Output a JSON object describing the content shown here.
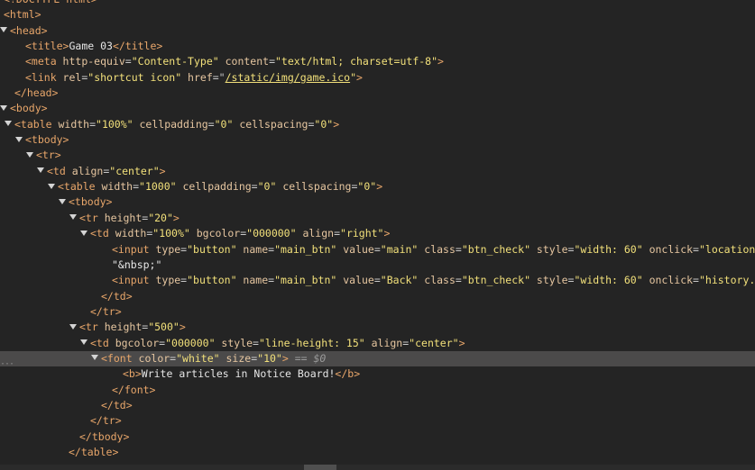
{
  "lines": [
    {
      "indent": 0,
      "toggle": "none",
      "segments": [
        {
          "cls": "tag",
          "text": "<!DOCTYPE html>"
        }
      ]
    },
    {
      "indent": 0,
      "toggle": "none",
      "segments": [
        {
          "cls": "tag",
          "text": "<html>"
        }
      ]
    },
    {
      "indent": 0,
      "toggle": "open",
      "segments": [
        {
          "cls": "tag",
          "text": "<head>"
        }
      ]
    },
    {
      "indent": 2,
      "toggle": "none",
      "segments": [
        {
          "cls": "tag",
          "text": "<title>"
        },
        {
          "cls": "txt",
          "text": "Game 03"
        },
        {
          "cls": "tag",
          "text": "</title>"
        }
      ]
    },
    {
      "indent": 2,
      "toggle": "none",
      "segments": [
        {
          "cls": "tag",
          "text": "<meta "
        },
        {
          "cls": "an",
          "text": "http-equiv"
        },
        {
          "cls": "eq",
          "text": "="
        },
        {
          "cls": "av",
          "text": "\"Content-Type\""
        },
        {
          "cls": "an",
          "text": " content"
        },
        {
          "cls": "eq",
          "text": "="
        },
        {
          "cls": "av",
          "text": "\"text/html; charset=utf-8\""
        },
        {
          "cls": "tag",
          "text": ">"
        }
      ]
    },
    {
      "indent": 2,
      "toggle": "none",
      "segments": [
        {
          "cls": "tag",
          "text": "<link "
        },
        {
          "cls": "an",
          "text": "rel"
        },
        {
          "cls": "eq",
          "text": "="
        },
        {
          "cls": "av",
          "text": "\"shortcut icon\""
        },
        {
          "cls": "an",
          "text": " href"
        },
        {
          "cls": "eq",
          "text": "=\""
        },
        {
          "cls": "link",
          "text": "/static/img/game.ico"
        },
        {
          "cls": "av",
          "text": "\""
        },
        {
          "cls": "tag",
          "text": ">"
        }
      ]
    },
    {
      "indent": 1,
      "toggle": "none",
      "segments": [
        {
          "cls": "tag",
          "text": "</head>"
        }
      ]
    },
    {
      "indent": 0,
      "toggle": "open",
      "segments": [
        {
          "cls": "tag",
          "text": "<body>"
        }
      ]
    },
    {
      "indent": 1,
      "toggle": "open",
      "segments": [
        {
          "cls": "tag",
          "text": "<table "
        },
        {
          "cls": "an",
          "text": "width"
        },
        {
          "cls": "eq",
          "text": "="
        },
        {
          "cls": "av",
          "text": "\"100%\""
        },
        {
          "cls": "an",
          "text": " cellpadding"
        },
        {
          "cls": "eq",
          "text": "="
        },
        {
          "cls": "av",
          "text": "\"0\""
        },
        {
          "cls": "an",
          "text": " cellspacing"
        },
        {
          "cls": "eq",
          "text": "="
        },
        {
          "cls": "av",
          "text": "\"0\""
        },
        {
          "cls": "tag",
          "text": ">"
        }
      ]
    },
    {
      "indent": 2,
      "toggle": "open",
      "segments": [
        {
          "cls": "tag",
          "text": "<tbody>"
        }
      ]
    },
    {
      "indent": 3,
      "toggle": "open",
      "segments": [
        {
          "cls": "tag",
          "text": "<tr>"
        }
      ]
    },
    {
      "indent": 4,
      "toggle": "open",
      "segments": [
        {
          "cls": "tag",
          "text": "<td "
        },
        {
          "cls": "an",
          "text": "align"
        },
        {
          "cls": "eq",
          "text": "="
        },
        {
          "cls": "av",
          "text": "\"center\""
        },
        {
          "cls": "tag",
          "text": ">"
        }
      ]
    },
    {
      "indent": 5,
      "toggle": "open",
      "segments": [
        {
          "cls": "tag",
          "text": "<table "
        },
        {
          "cls": "an",
          "text": "width"
        },
        {
          "cls": "eq",
          "text": "="
        },
        {
          "cls": "av",
          "text": "\"1000\""
        },
        {
          "cls": "an",
          "text": " cellpadding"
        },
        {
          "cls": "eq",
          "text": "="
        },
        {
          "cls": "av",
          "text": "\"0\""
        },
        {
          "cls": "an",
          "text": " cellspacing"
        },
        {
          "cls": "eq",
          "text": "="
        },
        {
          "cls": "av",
          "text": "\"0\""
        },
        {
          "cls": "tag",
          "text": ">"
        }
      ]
    },
    {
      "indent": 6,
      "toggle": "open",
      "segments": [
        {
          "cls": "tag",
          "text": "<tbody>"
        }
      ]
    },
    {
      "indent": 7,
      "toggle": "open",
      "segments": [
        {
          "cls": "tag",
          "text": "<tr "
        },
        {
          "cls": "an",
          "text": "height"
        },
        {
          "cls": "eq",
          "text": "="
        },
        {
          "cls": "av",
          "text": "\"20\""
        },
        {
          "cls": "tag",
          "text": ">"
        }
      ]
    },
    {
      "indent": 8,
      "toggle": "open",
      "segments": [
        {
          "cls": "tag",
          "text": "<td "
        },
        {
          "cls": "an",
          "text": "width"
        },
        {
          "cls": "eq",
          "text": "="
        },
        {
          "cls": "av",
          "text": "\"100%\""
        },
        {
          "cls": "an",
          "text": " bgcolor"
        },
        {
          "cls": "eq",
          "text": "="
        },
        {
          "cls": "av",
          "text": "\"000000\""
        },
        {
          "cls": "an",
          "text": " align"
        },
        {
          "cls": "eq",
          "text": "="
        },
        {
          "cls": "av",
          "text": "\"right\""
        },
        {
          "cls": "tag",
          "text": ">"
        }
      ]
    },
    {
      "indent": 10,
      "toggle": "none",
      "segments": [
        {
          "cls": "tag",
          "text": "<input "
        },
        {
          "cls": "an",
          "text": "type"
        },
        {
          "cls": "eq",
          "text": "="
        },
        {
          "cls": "av",
          "text": "\"button\""
        },
        {
          "cls": "an",
          "text": " name"
        },
        {
          "cls": "eq",
          "text": "="
        },
        {
          "cls": "av",
          "text": "\"main_btn\""
        },
        {
          "cls": "an",
          "text": " value"
        },
        {
          "cls": "eq",
          "text": "="
        },
        {
          "cls": "av",
          "text": "\"main\""
        },
        {
          "cls": "an",
          "text": " class"
        },
        {
          "cls": "eq",
          "text": "="
        },
        {
          "cls": "av",
          "text": "\"btn_check\""
        },
        {
          "cls": "an",
          "text": " style"
        },
        {
          "cls": "eq",
          "text": "="
        },
        {
          "cls": "av",
          "text": "\"width: 60\""
        },
        {
          "cls": "an",
          "text": " onclick"
        },
        {
          "cls": "eq",
          "text": "="
        },
        {
          "cls": "av",
          "text": "\"location.href = '/'\""
        },
        {
          "cls": "tag",
          "text": ">"
        }
      ]
    },
    {
      "indent": 10,
      "toggle": "none",
      "segments": [
        {
          "cls": "txt",
          "text": "\"&nbsp;\""
        }
      ]
    },
    {
      "indent": 10,
      "toggle": "none",
      "segments": [
        {
          "cls": "tag",
          "text": "<input "
        },
        {
          "cls": "an",
          "text": "type"
        },
        {
          "cls": "eq",
          "text": "="
        },
        {
          "cls": "av",
          "text": "\"button\""
        },
        {
          "cls": "an",
          "text": " name"
        },
        {
          "cls": "eq",
          "text": "="
        },
        {
          "cls": "av",
          "text": "\"main_btn\""
        },
        {
          "cls": "an",
          "text": " value"
        },
        {
          "cls": "eq",
          "text": "="
        },
        {
          "cls": "av",
          "text": "\"Back\""
        },
        {
          "cls": "an",
          "text": " class"
        },
        {
          "cls": "eq",
          "text": "="
        },
        {
          "cls": "av",
          "text": "\"btn_check\""
        },
        {
          "cls": "an",
          "text": " style"
        },
        {
          "cls": "eq",
          "text": "="
        },
        {
          "cls": "av",
          "text": "\"width: 60\""
        },
        {
          "cls": "an",
          "text": " onclick"
        },
        {
          "cls": "eq",
          "text": "="
        },
        {
          "cls": "av",
          "text": "\"history.back()\""
        },
        {
          "cls": "tag",
          "text": ">"
        }
      ]
    },
    {
      "indent": 9,
      "toggle": "none",
      "segments": [
        {
          "cls": "tag",
          "text": "</td>"
        }
      ]
    },
    {
      "indent": 8,
      "toggle": "none",
      "segments": [
        {
          "cls": "tag",
          "text": "</tr>"
        }
      ]
    },
    {
      "indent": 7,
      "toggle": "open",
      "segments": [
        {
          "cls": "tag",
          "text": "<tr "
        },
        {
          "cls": "an",
          "text": "height"
        },
        {
          "cls": "eq",
          "text": "="
        },
        {
          "cls": "av",
          "text": "\"500\""
        },
        {
          "cls": "tag",
          "text": ">"
        }
      ]
    },
    {
      "indent": 8,
      "toggle": "open",
      "segments": [
        {
          "cls": "tag",
          "text": "<td "
        },
        {
          "cls": "an",
          "text": "bgcolor"
        },
        {
          "cls": "eq",
          "text": "="
        },
        {
          "cls": "av",
          "text": "\"000000\""
        },
        {
          "cls": "an",
          "text": " style"
        },
        {
          "cls": "eq",
          "text": "="
        },
        {
          "cls": "av",
          "text": "\"line-height: 15\""
        },
        {
          "cls": "an",
          "text": " align"
        },
        {
          "cls": "eq",
          "text": "="
        },
        {
          "cls": "av",
          "text": "\"center\""
        },
        {
          "cls": "tag",
          "text": ">"
        }
      ]
    },
    {
      "indent": 9,
      "toggle": "open",
      "selected": true,
      "segments": [
        {
          "cls": "tag",
          "text": "<font "
        },
        {
          "cls": "an",
          "text": "color"
        },
        {
          "cls": "eq",
          "text": "="
        },
        {
          "cls": "av",
          "text": "\"white\""
        },
        {
          "cls": "an",
          "text": " size"
        },
        {
          "cls": "eq",
          "text": "="
        },
        {
          "cls": "av",
          "text": "\"10\""
        },
        {
          "cls": "tag",
          "text": ">"
        },
        {
          "cls": "marker",
          "text": " == $0"
        }
      ]
    },
    {
      "indent": 11,
      "toggle": "none",
      "segments": [
        {
          "cls": "tag",
          "text": "<b>"
        },
        {
          "cls": "txt",
          "text": "Write articles in Notice Board!"
        },
        {
          "cls": "tag",
          "text": "</b>"
        }
      ]
    },
    {
      "indent": 10,
      "toggle": "none",
      "segments": [
        {
          "cls": "tag",
          "text": "</font>"
        }
      ]
    },
    {
      "indent": 9,
      "toggle": "none",
      "segments": [
        {
          "cls": "tag",
          "text": "</td>"
        }
      ]
    },
    {
      "indent": 8,
      "toggle": "none",
      "segments": [
        {
          "cls": "tag",
          "text": "</tr>"
        }
      ]
    },
    {
      "indent": 7,
      "toggle": "none",
      "segments": [
        {
          "cls": "tag",
          "text": "</tbody>"
        }
      ]
    },
    {
      "indent": 6,
      "toggle": "none",
      "segments": [
        {
          "cls": "tag",
          "text": "</table>"
        }
      ]
    }
  ],
  "colors": {
    "background": "#242424",
    "tag": "#e8a66a",
    "attr_name": "#e6c6a0",
    "attr_value": "#f2e07a",
    "selected_row": "#4b4a4a"
  }
}
